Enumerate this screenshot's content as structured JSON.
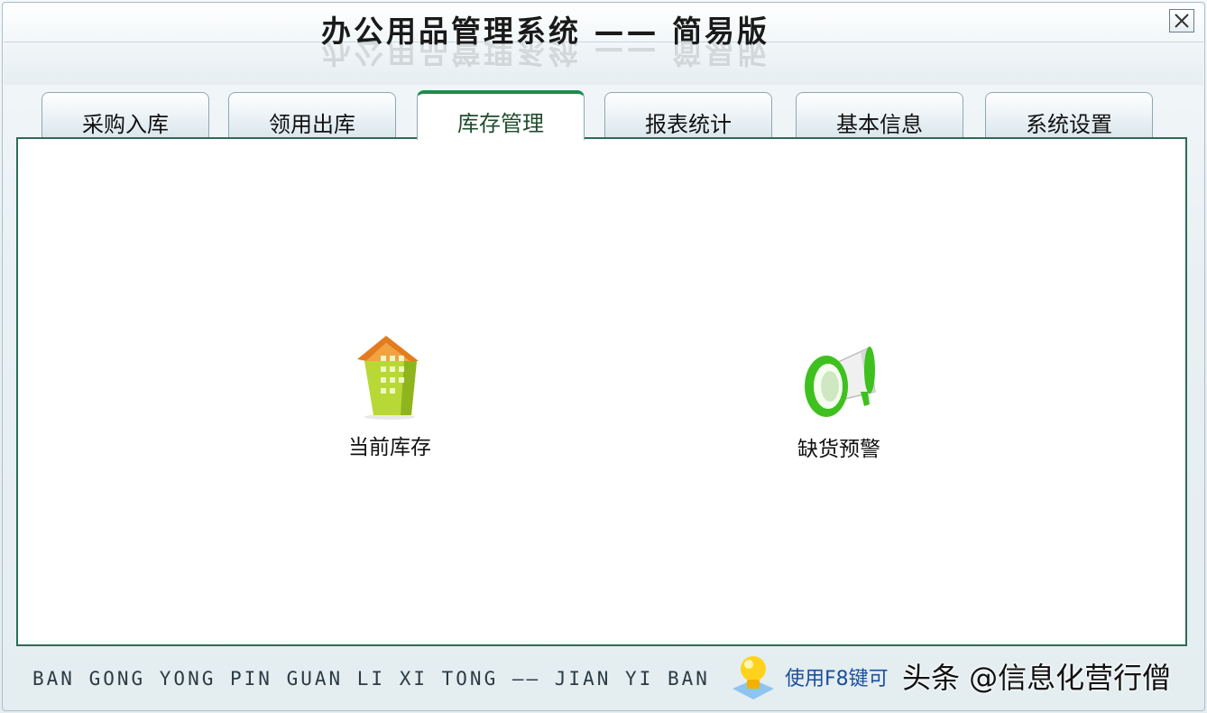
{
  "window": {
    "title": "办公用品管理系统 —— 简易版"
  },
  "tabs": [
    {
      "label": "采购入库",
      "active": false
    },
    {
      "label": "领用出库",
      "active": false
    },
    {
      "label": "库存管理",
      "active": true
    },
    {
      "label": "报表统计",
      "active": false
    },
    {
      "label": "基本信息",
      "active": false
    },
    {
      "label": "系统设置",
      "active": false
    }
  ],
  "main": {
    "items": [
      {
        "label": "当前库存",
        "icon": "building-icon"
      },
      {
        "label": "缺货预警",
        "icon": "megaphone-icon"
      }
    ]
  },
  "footer": {
    "pinyin": "BAN GONG YONG PIN GUAN LI XI TONG —— JIAN YI BAN",
    "tip": "使用F8键可",
    "watermark": "头条 @信息化营行僧"
  },
  "colors": {
    "accent": "#1f8b4c",
    "tip": "#1b4f9c",
    "border": "#2b6d55"
  }
}
